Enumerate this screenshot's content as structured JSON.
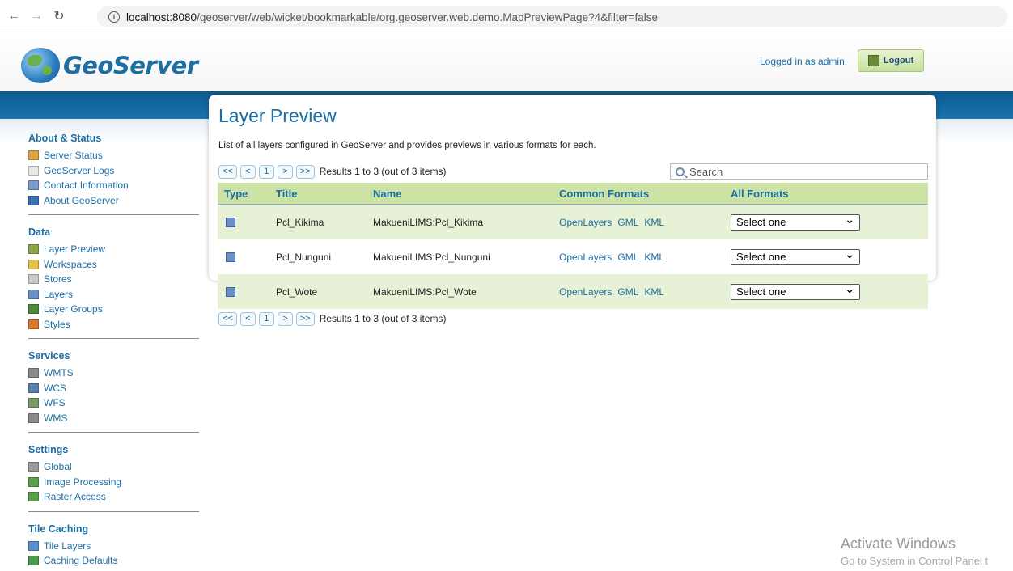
{
  "browser": {
    "url_host": "localhost:8080",
    "url_path": "/geoserver/web/wicket/bookmarkable/org.geoserver.web.demo.MapPreviewPage?4&filter=false"
  },
  "header": {
    "logo_text": "GeoServer",
    "logged_in_text": "Logged in as admin.",
    "logout_label": "Logout"
  },
  "sidebar": {
    "sections": [
      {
        "title": "About & Status",
        "items": [
          {
            "label": "Server Status",
            "icon": "server-status-icon",
            "color": "#d9a441"
          },
          {
            "label": "GeoServer Logs",
            "icon": "logs-icon",
            "color": "#e8e8e8"
          },
          {
            "label": "Contact Information",
            "icon": "contact-icon",
            "color": "#7a9bc7"
          },
          {
            "label": "About GeoServer",
            "icon": "about-icon",
            "color": "#3d6fb0"
          }
        ]
      },
      {
        "title": "Data",
        "items": [
          {
            "label": "Layer Preview",
            "icon": "layer-preview-icon",
            "color": "#8ba34a"
          },
          {
            "label": "Workspaces",
            "icon": "workspaces-icon",
            "color": "#e6c14a"
          },
          {
            "label": "Stores",
            "icon": "stores-icon",
            "color": "#c9c9c9"
          },
          {
            "label": "Layers",
            "icon": "layers-icon",
            "color": "#6d8fc7"
          },
          {
            "label": "Layer Groups",
            "icon": "layer-groups-icon",
            "color": "#4e8a3a"
          },
          {
            "label": "Styles",
            "icon": "styles-icon",
            "color": "#d9792b"
          }
        ]
      },
      {
        "title": "Services",
        "items": [
          {
            "label": "WMTS",
            "icon": "wmts-icon",
            "color": "#8a8a8a"
          },
          {
            "label": "WCS",
            "icon": "wcs-icon",
            "color": "#5a7fb0"
          },
          {
            "label": "WFS",
            "icon": "wfs-icon",
            "color": "#7a9a6a"
          },
          {
            "label": "WMS",
            "icon": "wms-icon",
            "color": "#8a8a8a"
          }
        ]
      },
      {
        "title": "Settings",
        "items": [
          {
            "label": "Global",
            "icon": "global-icon",
            "color": "#9a9a9a"
          },
          {
            "label": "Image Processing",
            "icon": "image-processing-icon",
            "color": "#5aa04a"
          },
          {
            "label": "Raster Access",
            "icon": "raster-access-icon",
            "color": "#5aa04a"
          }
        ]
      },
      {
        "title": "Tile Caching",
        "items": [
          {
            "label": "Tile Layers",
            "icon": "tile-layers-icon",
            "color": "#5a8fd0"
          },
          {
            "label": "Caching Defaults",
            "icon": "caching-defaults-icon",
            "color": "#4a9a4a"
          }
        ]
      }
    ]
  },
  "main": {
    "title": "Layer Preview",
    "description": "List of all layers configured in GeoServer and provides previews in various formats for each.",
    "pager": {
      "first": "<<",
      "prev": "<",
      "page": "1",
      "next": ">",
      "last": ">>",
      "results": "Results 1 to 3 (out of 3 items)"
    },
    "search_placeholder": "Search",
    "columns": [
      "Type",
      "Title",
      "Name",
      "Common Formats",
      "All Formats"
    ],
    "rows": [
      {
        "title": "Pcl_Kikima",
        "name": "MakueniLIMS:Pcl_Kikima",
        "formats": [
          "OpenLayers",
          "GML",
          "KML"
        ],
        "all_formats": "Select one"
      },
      {
        "title": "Pcl_Nunguni",
        "name": "MakueniLIMS:Pcl_Nunguni",
        "formats": [
          "OpenLayers",
          "GML",
          "KML"
        ],
        "all_formats": "Select one"
      },
      {
        "title": "Pcl_Wote",
        "name": "MakueniLIMS:Pcl_Wote",
        "formats": [
          "OpenLayers",
          "GML",
          "KML"
        ],
        "all_formats": "Select one"
      }
    ]
  },
  "watermark": {
    "line1": "Activate Windows",
    "line2": "Go to System in Control Panel t"
  }
}
